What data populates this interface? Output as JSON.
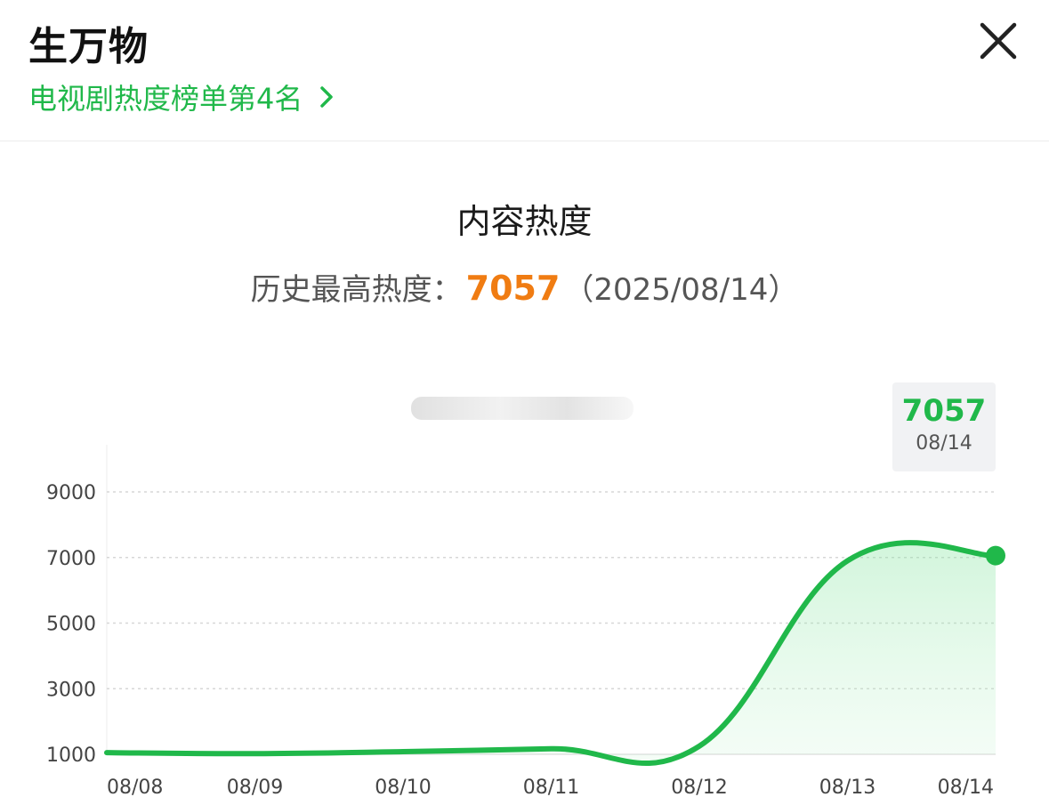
{
  "header": {
    "title": "生万物",
    "rank_link": "电视剧热度榜单第4名"
  },
  "icons": {
    "close": "close-icon",
    "chevron": "chevron-right-icon"
  },
  "summary": {
    "heading": "内容热度",
    "peak_label": "历史最高热度：",
    "peak_value": "7057",
    "peak_date": "（2025/08/14）"
  },
  "tooltip": {
    "value": "7057",
    "date": "08/14"
  },
  "colors": {
    "accent": "#20b84a",
    "peak": "#f07c12",
    "grid": "#d7d7d7"
  },
  "chart_data": {
    "type": "area",
    "categories": [
      "08/08",
      "08/09",
      "08/10",
      "08/11",
      "08/12",
      "08/13",
      "08/14"
    ],
    "values": [
      1050,
      1020,
      1080,
      1170,
      1250,
      6900,
      7057
    ],
    "y_ticks": [
      "1000",
      "3000",
      "5000",
      "7000",
      "9000"
    ],
    "ylim": [
      1000,
      9000
    ],
    "grid": true,
    "highlighted_point": {
      "x": "08/14",
      "value": 7057
    }
  }
}
